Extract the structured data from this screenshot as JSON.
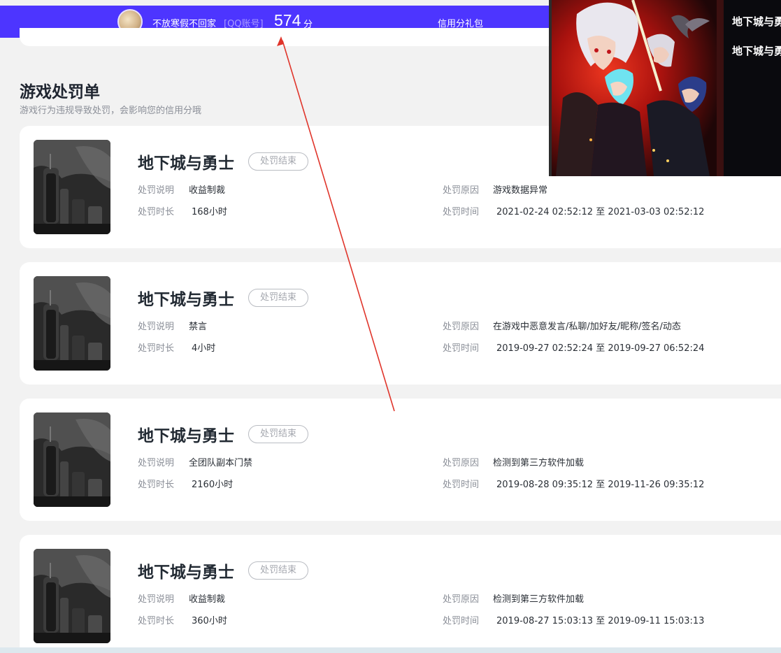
{
  "header": {
    "username": "不放寒假不回家",
    "account_type": "[QQ账号]",
    "score": "574",
    "score_unit": "分",
    "gift_link": "信用分礼包"
  },
  "section": {
    "title": "游戏处罚单",
    "subtitle": "游戏行为违规导致处罚，会影响您的信用分哦"
  },
  "labels": {
    "desc": "处罚说明",
    "duration": "处罚时长",
    "reason": "处罚原因",
    "time": "处罚时间"
  },
  "records": [
    {
      "game": "地下城与勇士",
      "status": "处罚结束",
      "desc": "收益制裁",
      "duration": "168小时",
      "reason": "游戏数据异常",
      "time": "2021-02-24 02:52:12 至 2021-03-03 02:52:12"
    },
    {
      "game": "地下城与勇士",
      "status": "处罚结束",
      "desc": "禁言",
      "duration": "4小时",
      "reason": "在游戏中恶意发言/私聊/加好友/昵称/签名/动态",
      "time": "2019-09-27 02:52:24 至 2019-09-27 06:52:24"
    },
    {
      "game": "地下城与勇士",
      "status": "处罚结束",
      "desc": "全团队副本门禁",
      "duration": "2160小时",
      "reason": "检测到第三方软件加载",
      "time": "2019-08-28 09:35:12 至 2019-11-26 09:35:12"
    },
    {
      "game": "地下城与勇士",
      "status": "处罚结束",
      "desc": "收益制裁",
      "duration": "360小时",
      "reason": "检测到第三方软件加载",
      "time": "2019-08-27 15:03:13 至 2019-09-11 15:03:13"
    }
  ],
  "overlay": {
    "logo_text": "地下城与勇士",
    "icon": "game-promo-artwork"
  },
  "colors": {
    "header_bg": "#4d35ff",
    "arrow": "#e0352b"
  }
}
